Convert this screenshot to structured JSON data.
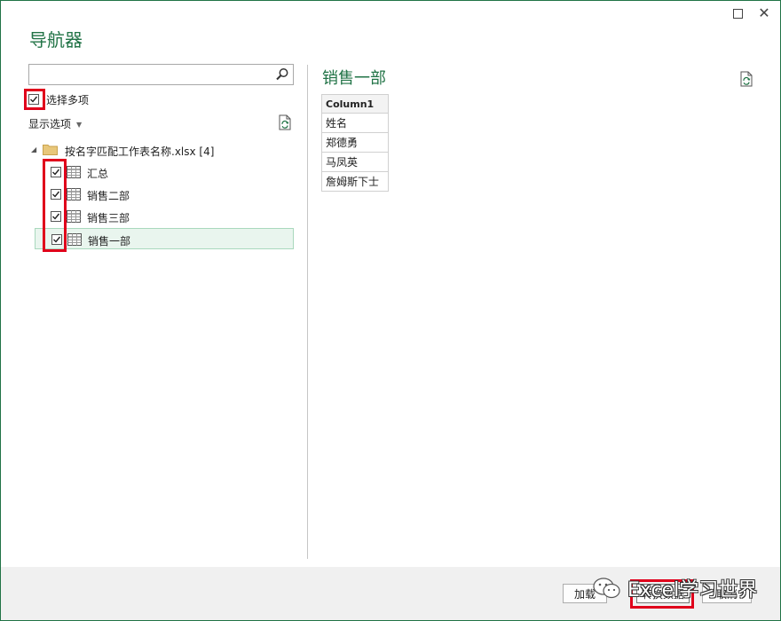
{
  "window": {
    "title": "导航器",
    "maximize_label": "",
    "close_label": "✕"
  },
  "search": {
    "value": "",
    "placeholder": ""
  },
  "multi_select": {
    "label": "选择多项",
    "checked": true
  },
  "display_options": {
    "label": "显示选项"
  },
  "tree": {
    "root_label": "按名字匹配工作表名称.xlsx [4]",
    "items": [
      {
        "label": "汇总",
        "checked": true,
        "selected": false
      },
      {
        "label": "销售二部",
        "checked": true,
        "selected": false
      },
      {
        "label": "销售三部",
        "checked": true,
        "selected": false
      },
      {
        "label": "销售一部",
        "checked": true,
        "selected": true
      }
    ]
  },
  "preview": {
    "title": "销售一部",
    "columns": [
      "Column1"
    ],
    "rows": [
      "姓名",
      "郑德勇",
      "马凤英",
      "詹姆斯下士"
    ]
  },
  "buttons": {
    "load": "加载",
    "transform": "转换数据",
    "cancel": "取消"
  },
  "watermark": {
    "text": "Excel学习世界"
  },
  "colors": {
    "accent": "#217346",
    "highlight": "#e0001b",
    "selected_bg": "#e9f5ee"
  }
}
